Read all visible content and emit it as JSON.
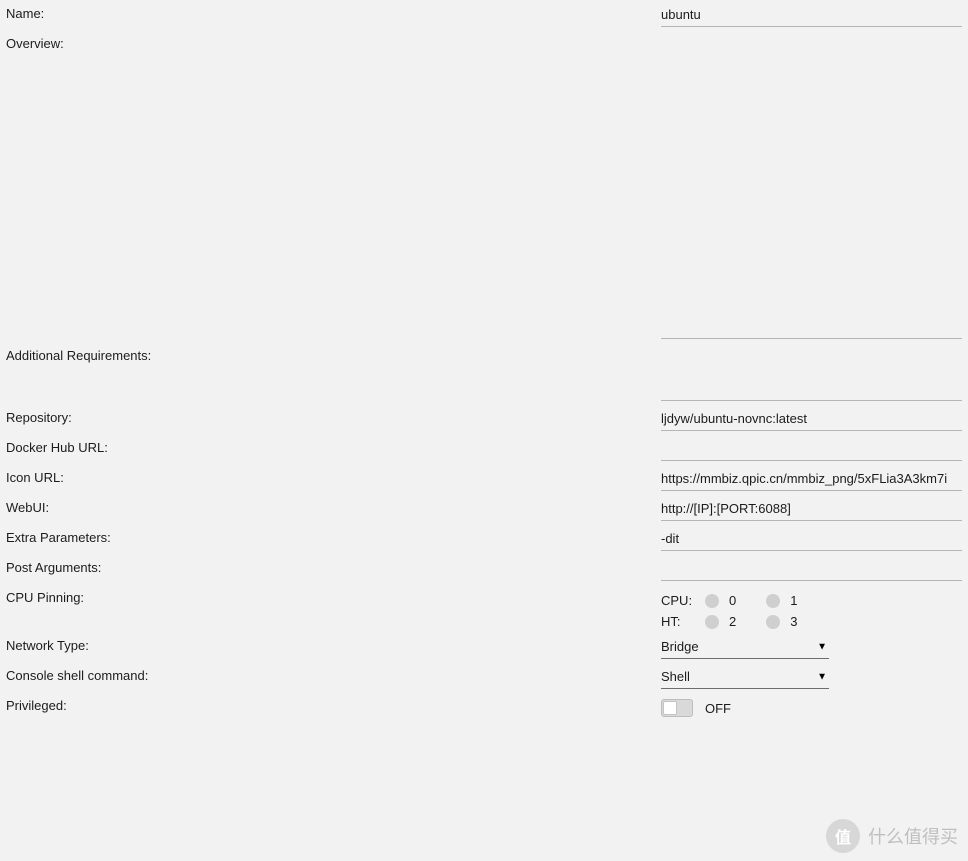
{
  "labels": {
    "name": "Name:",
    "overview": "Overview:",
    "additional": "Additional Requirements:",
    "repository": "Repository:",
    "docker_hub": "Docker Hub URL:",
    "icon_url": "Icon URL:",
    "webui": "WebUI:",
    "extra_params": "Extra Parameters:",
    "post_args": "Post Arguments:",
    "cpu_pinning": "CPU Pinning:",
    "network_type": "Network Type:",
    "console_shell": "Console shell command:",
    "privileged": "Privileged:"
  },
  "values": {
    "name": "ubuntu",
    "overview": "",
    "additional": "",
    "repository": "ljdyw/ubuntu-novnc:latest",
    "docker_hub": "",
    "icon_url": "https://mmbiz.qpic.cn/mmbiz_png/5xFLia3A3km7i",
    "webui": "http://[IP]:[PORT:6088]",
    "extra_params": "-dit",
    "post_args": "",
    "network_type": "Bridge",
    "console_shell": "Shell",
    "privileged_state": "OFF"
  },
  "cpu": {
    "row1_label": "CPU:",
    "row2_label": "HT:",
    "core0": "0",
    "core1": "1",
    "core2": "2",
    "core3": "3"
  },
  "watermark": {
    "badge": "值",
    "text": "什么值得买"
  }
}
